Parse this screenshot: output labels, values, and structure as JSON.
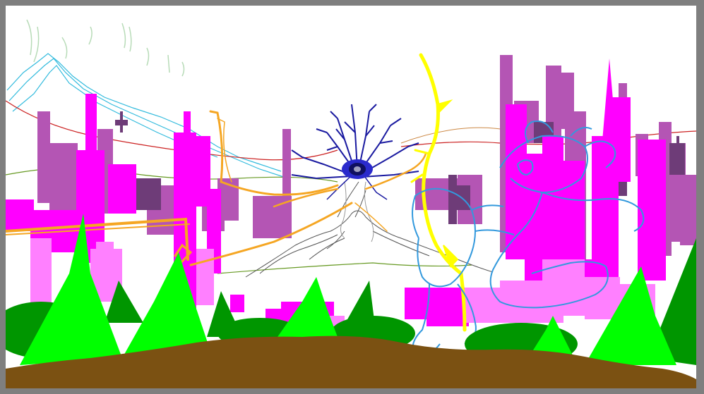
{
  "scene": {
    "palette": {
      "frame": "#7f7f7f",
      "sky": "#ffffff",
      "magenta": "#ff00ff",
      "orchid": "#b455b4",
      "pink": "#ff80ff",
      "plum": "#6e3c78",
      "tree_bright": "#00ff00",
      "tree_dark": "#009600",
      "ground": "#7b5112",
      "orange": "#f5a623",
      "yellow": "#ffff00",
      "navy": "#1a1aa0",
      "cyan": "#3399dd",
      "sketch_gray": "#555555",
      "red_line": "#cc2222",
      "olive_line": "#669922"
    }
  }
}
